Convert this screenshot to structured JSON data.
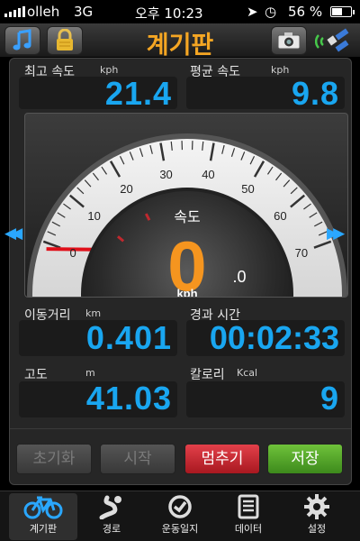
{
  "status": {
    "carrier": "olleh",
    "network": "3G",
    "time": "오후 10:23",
    "battery_pct_label": "56 %",
    "battery_level": 0.56
  },
  "header": {
    "title": "계기판"
  },
  "stats": {
    "max_speed": {
      "label": "최고 속도",
      "unit": "kph",
      "value": "21.4"
    },
    "avg_speed": {
      "label": "평균 속도",
      "unit": "kph",
      "value": "9.8"
    },
    "distance": {
      "label": "이동거리",
      "unit": "km",
      "value": "0.401"
    },
    "elapsed": {
      "label": "경과 시간",
      "value": "00:02:33"
    },
    "altitude": {
      "label": "고도",
      "unit": "m",
      "value": "41.03"
    },
    "calories": {
      "label": "칼로리",
      "unit": "Kcal",
      "value": "9"
    }
  },
  "gauge": {
    "title": "속도",
    "speed": "0",
    "decimal": ".0",
    "unit": "kph",
    "ticks": [
      "0",
      "10",
      "20",
      "30",
      "40",
      "50",
      "60",
      "70"
    ],
    "max": 70,
    "max_marker": 21.4,
    "avg_marker": 9.8
  },
  "actions": {
    "reset": "초기화",
    "start": "시작",
    "stop": "멈추기",
    "save": "저장"
  },
  "tabs": [
    {
      "label": "계기판",
      "icon": "bicycle-icon",
      "active": true
    },
    {
      "label": "경로",
      "icon": "route-icon",
      "active": false
    },
    {
      "label": "운동일지",
      "icon": "checkmark-circle-icon",
      "active": false
    },
    {
      "label": "데이터",
      "icon": "list-icon",
      "active": false
    },
    {
      "label": "설정",
      "icon": "gear-icon",
      "active": false
    }
  ],
  "colors": {
    "accent_orange": "#f5a623",
    "value_blue": "#19a6f0",
    "stop_red": "#d8303a",
    "save_green": "#5aab2e"
  }
}
